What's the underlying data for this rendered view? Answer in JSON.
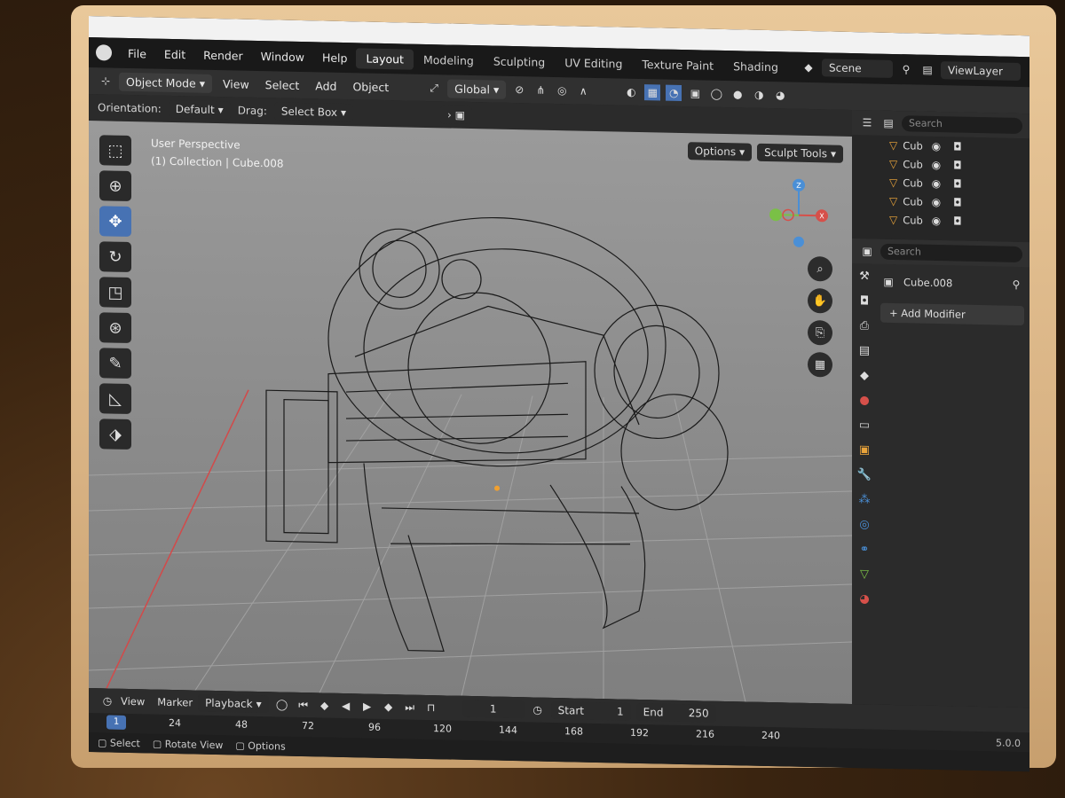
{
  "menubar": {
    "items": [
      "File",
      "Edit",
      "Render",
      "Window",
      "Help"
    ],
    "workspaces": [
      "Layout",
      "Modeling",
      "Sculpting",
      "UV Editing",
      "Texture Paint",
      "Shading"
    ],
    "active_workspace": "Layout",
    "scene": "Scene",
    "view_layer": "ViewLayer"
  },
  "header": {
    "mode": "Object Mode",
    "menus": [
      "View",
      "Select",
      "Add",
      "Object"
    ],
    "transform": "Global"
  },
  "tool_options": {
    "orientation_label": "Orientation:",
    "orientation_value": "Default",
    "drag_label": "Drag:",
    "drag_value": "Select Box",
    "options": "Options",
    "sculpt_tools": "Sculpt Tools"
  },
  "viewport": {
    "perspective": "User Perspective",
    "collection": "(1) Collection | Cube.008"
  },
  "gizmo": {
    "z": "Z",
    "x": "X"
  },
  "outliner": {
    "search_placeholder": "Search",
    "rows": [
      "Cub",
      "Cub",
      "Cub",
      "Cub",
      "Cub"
    ]
  },
  "properties": {
    "search_placeholder": "Search",
    "object_name": "Cube.008",
    "add_modifier": "Add Modifier"
  },
  "timeline": {
    "menus": [
      "View",
      "Marker"
    ],
    "playback": "Playback",
    "current_frame": "1",
    "start_label": "Start",
    "start_value": "1",
    "end_label": "End",
    "end_value": "250",
    "ticks": [
      "24",
      "48",
      "72",
      "96",
      "120",
      "144",
      "168",
      "192",
      "216",
      "240"
    ],
    "marker_frame": "1"
  },
  "status": {
    "select": "Select",
    "rotate": "Rotate View",
    "options": "Options",
    "version": "5.0.0"
  }
}
